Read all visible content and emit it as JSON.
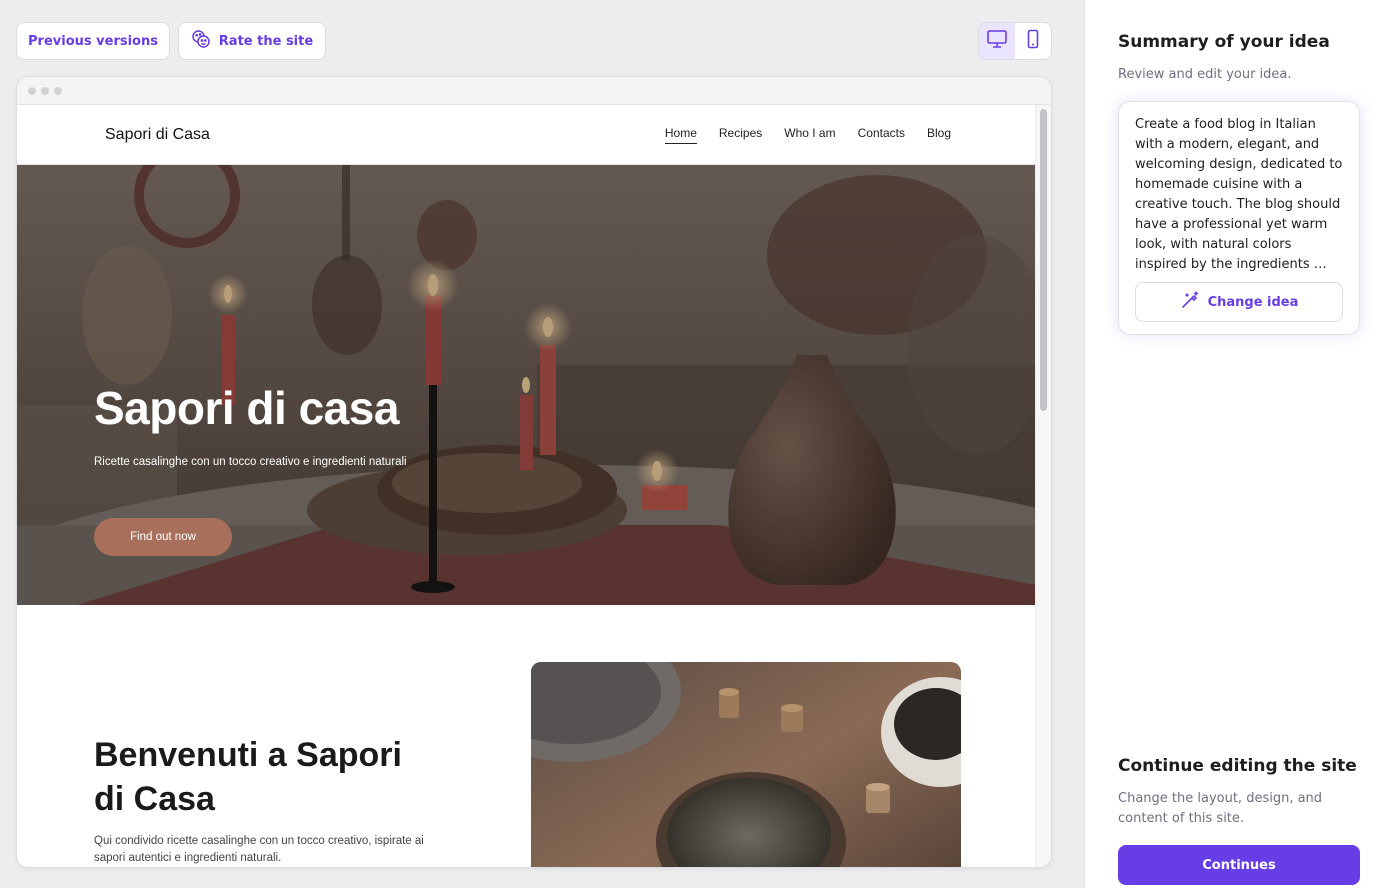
{
  "toolbar": {
    "previous_versions_label": "Previous versions",
    "rate_label": "Rate the site",
    "rate_icon": "smiley-faces-icon",
    "desktop_icon": "desktop-icon",
    "mobile_icon": "mobile-icon",
    "active_device": "desktop"
  },
  "site": {
    "logo": "Sapori di Casa",
    "nav": [
      {
        "label": "Home",
        "active": true
      },
      {
        "label": "Recipes",
        "active": false
      },
      {
        "label": "Who I am",
        "active": false
      },
      {
        "label": "Contacts",
        "active": false
      },
      {
        "label": "Blog",
        "active": false
      }
    ],
    "hero": {
      "title": "Sapori di casa",
      "subtitle": "Ricette casalinghe con un tocco creativo e ingredienti naturali",
      "cta": "Find out now"
    },
    "welcome": {
      "title": "Benvenuti a Sapori di Casa",
      "text": "Qui condivido ricette casalinghe con un tocco creativo, ispirate ai sapori autentici e ingredienti naturali."
    }
  },
  "panel": {
    "summary_title": "Summary of your idea",
    "summary_subtitle": "Review and edit your idea.",
    "idea_text": "Create a food blog in Italian with a modern, elegant, and welcoming design, dedicated to homemade cuisine with a creative touch. The blog should have a professional yet warm look, with natural colors inspired by the ingredients …",
    "change_idea_label": "Change idea",
    "change_icon": "magic-wand-icon",
    "continue_title": "Continue editing the site",
    "continue_subtitle": "Change the layout, design, and content of this site.",
    "continue_button": "Continues"
  },
  "colors": {
    "accent": "#673de6",
    "hero_button": "#a8705a",
    "background": "#ededf0"
  }
}
